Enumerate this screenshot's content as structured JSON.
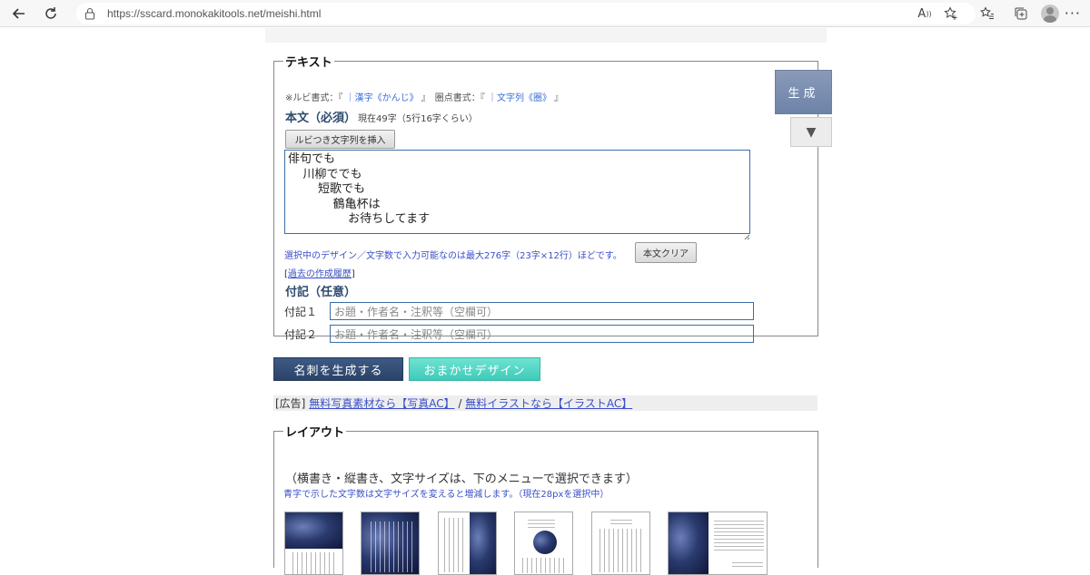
{
  "browser": {
    "url": "https://sscard.monokakitools.net/meishi.html"
  },
  "text_section": {
    "legend": "テキスト",
    "ruby_note_prefix": "※ルビ書式：『",
    "ruby_note_format": "｜漢字《かんじ》",
    "ruby_note_mid": "』　圏点書式：『",
    "kenten_format": "｜文字列《圏》",
    "ruby_note_suffix": "』",
    "body_label": "本文（必須）",
    "body_count": "現在49字（5行16字くらい）",
    "insert_ruby_button": "ルビつき文字列を挿入",
    "body_text": "俳句でも\n    川柳ででも\n        短歌でも\n            鶴亀杯は\n                お待ちしてます",
    "limit_note": "選択中のデザイン／文字数で入力可能なのは最大276字（23字×12行）ほどです。",
    "clear_button": "本文クリア",
    "history_open": "[",
    "history_link": "過去の作成履歴",
    "history_close": "]",
    "fuki_label": "付記（任意）",
    "fuki1_label": "付記１",
    "fuki1_placeholder": "お題・作者名・注釈等（空欄可）",
    "fuki2_label": "付記２",
    "fuki2_placeholder": "お題・作者名・注釈等（空欄可）"
  },
  "side": {
    "generate_button": "生成",
    "down_button": "▼"
  },
  "actions": {
    "meishi_button": "名刺を生成する",
    "omakase_button": "おまかせデザイン"
  },
  "ad": {
    "prefix": "[広告]",
    "link1": "無料写真素材なら【写真AC】",
    "sep": "/",
    "link2": "無料イラストなら【イラストAC】"
  },
  "layout_section": {
    "legend": "レイアウト",
    "description": "（横書き・縦書き、文字サイズは、下のメニューで選択できます）",
    "note": "青字で示した文字数は文字サイズを変えると増減します。（現在28pxを選択中）"
  },
  "colors": {
    "primary": "#2c4368",
    "accent": "#3fcab8",
    "link": "#3a4fc8"
  }
}
